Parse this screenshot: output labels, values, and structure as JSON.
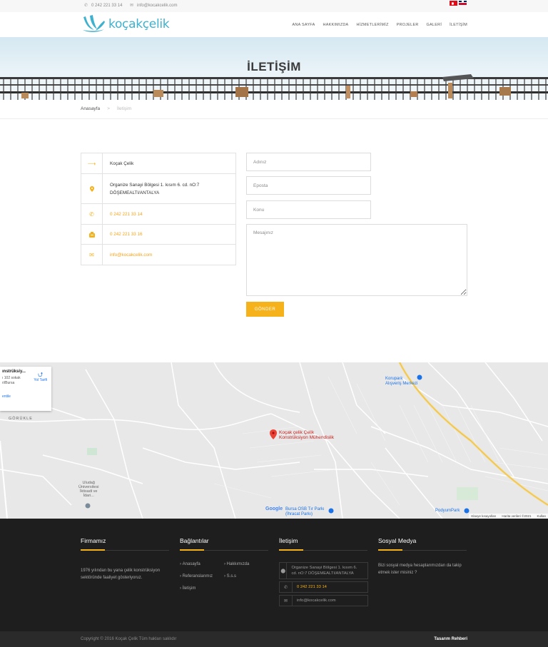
{
  "topbar": {
    "phone": "0 242 221 33 14",
    "email": "info@kocakcelik.com",
    "phone_icon": "phone-icon",
    "email_icon": "envelope-icon"
  },
  "header": {
    "logo_text": "koçakçelik",
    "nav": [
      "ANA SAYFA",
      "HAKKIMIZDA",
      "HİZMETLERİMİZ",
      "PROJELER",
      "GALERİ",
      "İLETİŞİM"
    ]
  },
  "banner": {
    "title": "İLETİŞİM"
  },
  "breadcrumb": {
    "home": "Anasayfa",
    "separator": ">",
    "current": "İletişim"
  },
  "contact": {
    "company": "Koçak Çelik",
    "address_line1": "Organize Sanayi Bölgesi 1. kısım 6. cd. nO:7",
    "address_line2": "DÖŞEMEALTI/ANTALYA",
    "phone": "0 242 221 33 14",
    "fax": "0 242 221 33 16",
    "email": "info@kocakcelik.com",
    "icons": [
      "arrow-right-icon",
      "map-marker-icon",
      "phone-icon",
      "fax-icon",
      "envelope-icon"
    ]
  },
  "form": {
    "name_placeholder": "Adınız",
    "email_placeholder": "Eposta",
    "subject_placeholder": "Konu",
    "message_placeholder": "Mesajınız",
    "submit_label": "GÖNDER"
  },
  "map": {
    "card_title": "ınstrüksiy...",
    "card_address_1": "ı 102 sokak",
    "card_address_2": "ri/Bursa",
    "card_link": "entile",
    "directions_label": "Yol Tarifi",
    "pin_label_1": "Koçak çelik Çelik",
    "pin_label_2": "Konstrüksiyon Mühendislik",
    "area_gorukle": "GÖRÜKLE",
    "uni_1": "Uludağ",
    "uni_2": "Üniversitesi",
    "uni_3": "İktisadi ve",
    "uni_4": "İdari...",
    "korupark_1": "Korupark",
    "korupark_2": "Alışveriş Merkezi",
    "podyum": "PodyumPark",
    "bursa_osb_1": "Bursa OSB Tır Parkı",
    "bursa_osb_2": "(İhracat Parkı)",
    "google": "Google",
    "attr_shortcuts": "Klavye kısayolları",
    "attr_data": "Harita verileri ©2021",
    "attr_terms": "Kullan"
  },
  "footer": {
    "col1_title": "Firmamız",
    "col1_text": "1976 yılından bu yana çelik konstrüksiyon sektöründe faaliyet gösteriyoruz.",
    "col2_title": "Bağlantılar",
    "links": [
      "Anasayfa",
      "Hakkımızda",
      "Referanslarımız",
      "S.s.s",
      "İletişim"
    ],
    "col3_title": "İletişim",
    "address": "Organize Sanayi Bölgesi 1. kısım 6. cd. nO:7 DÖŞEMEALTI/ANTALYA",
    "phone": "0 242 221 33 14",
    "email": "info@kocakcelik.com",
    "col4_title": "Sosyal Medya",
    "col4_text": "Bizi sosyal medya hesaplarımızdan da takip etmek ister misiniz ?",
    "copyright": "Copyright © 2016 Koçak Çelik Tüm hakları saklıdır",
    "credit": "Tasarım Rehberi"
  },
  "colors": {
    "accent": "#f6b21a",
    "brand": "#3eb1cf",
    "footer": "#1e1e1e"
  }
}
